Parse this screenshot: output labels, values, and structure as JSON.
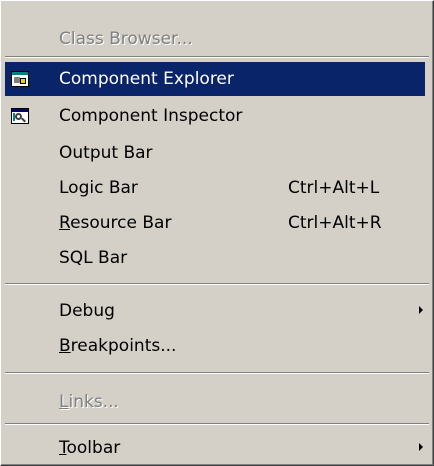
{
  "menu": {
    "class_browser": {
      "label": "Class Browser..."
    },
    "component_explorer": {
      "label": "Component Explorer",
      "icon": "component-explorer-icon"
    },
    "component_inspector": {
      "label": "Component Inspector",
      "icon": "component-inspector-icon"
    },
    "output_bar": {
      "label": "Output Bar"
    },
    "logic_bar": {
      "label": "Logic Bar",
      "shortcut": "Ctrl+Alt+L"
    },
    "resource_bar": {
      "label_mnemonic": "R",
      "label_rest": "esource Bar",
      "shortcut": "Ctrl+Alt+R"
    },
    "sql_bar": {
      "label": "SQL Bar"
    },
    "debug": {
      "label": "Debug",
      "submenu": "submenu-arrow-icon"
    },
    "breakpoints": {
      "label_mnemonic": "B",
      "label_rest": "reakpoints..."
    },
    "links": {
      "label_mnemonic": "L",
      "label_rest": "inks..."
    },
    "toolbar": {
      "label_mnemonic": "T",
      "label_rest": "oolbar",
      "submenu": "submenu-arrow-icon"
    }
  },
  "colors": {
    "menu_bg": "#d4d0c8",
    "highlight_bg": "#0a246a",
    "highlight_text": "#ffffff",
    "disabled_text": "#808080"
  }
}
